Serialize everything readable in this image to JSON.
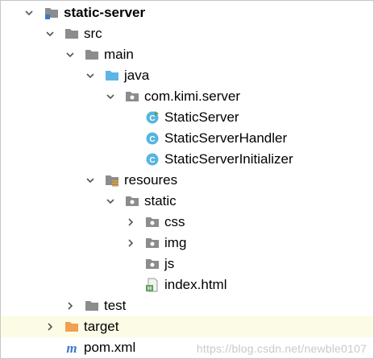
{
  "tree": {
    "root_label": "static-server",
    "src_label": "src",
    "main_label": "main",
    "java_label": "java",
    "package_label": "com.kimi.server",
    "class1_label": "StaticServer",
    "class2_label": "StaticServerHandler",
    "class3_label": "StaticServerInitializer",
    "resources_label": "resoures",
    "static_label": "static",
    "css_label": "css",
    "img_label": "img",
    "js_label": "js",
    "index_label": "index.html",
    "test_label": "test",
    "target_label": "target",
    "pom_label": "pom.xml"
  },
  "icons": {
    "folder_gray": "#8c8c8c",
    "folder_blue": "#5fb4e6",
    "folder_orange": "#f0a050",
    "class_circle": "#56b4e0",
    "maven_m": "#3d79c7",
    "html_green": "#5aa05a",
    "chevron": "#555555"
  },
  "watermark_text": "https://blog.csdn.net/newble0107"
}
